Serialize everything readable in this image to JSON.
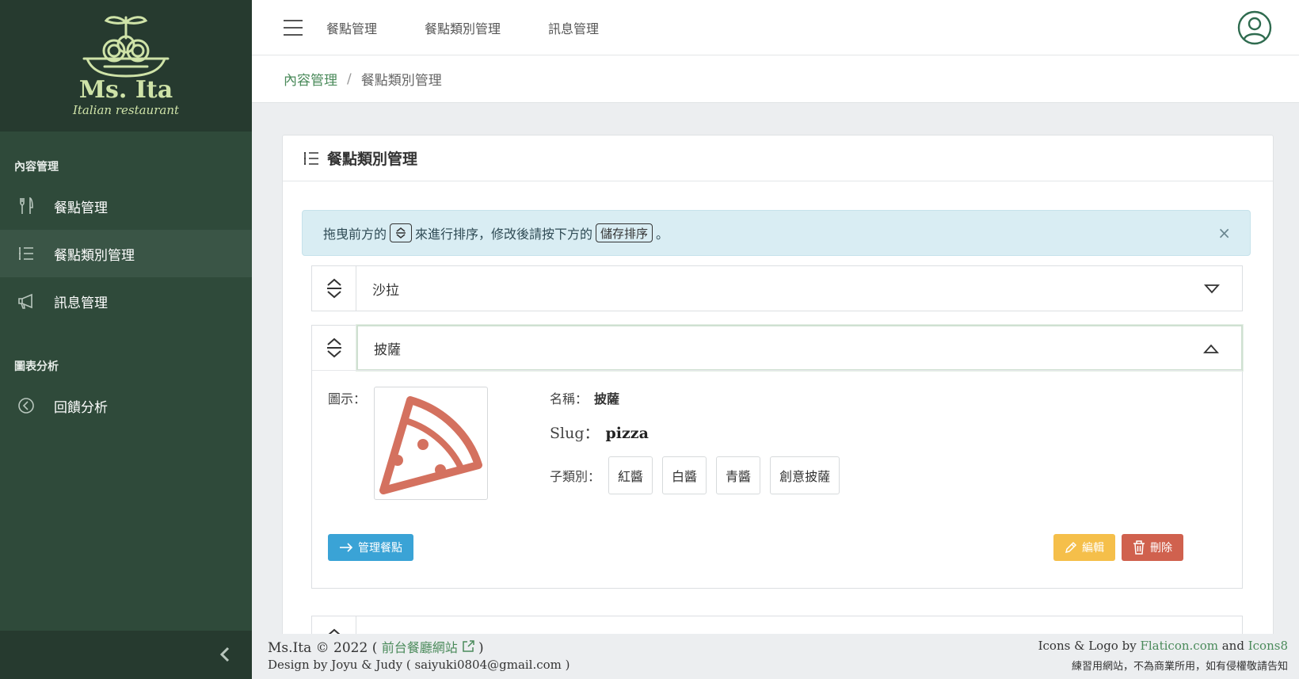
{
  "brand": {
    "name": "Ms. Ita",
    "subtitle": "Italian restaurant",
    "logo_color": "#cfe3a8"
  },
  "sidebar": {
    "sections": [
      {
        "label": "內容管理",
        "items": [
          {
            "label": "餐點管理",
            "icon": "fork-knife-icon",
            "active": false
          },
          {
            "label": "餐點類別管理",
            "icon": "list-icon",
            "active": true
          },
          {
            "label": "訊息管理",
            "icon": "megaphone-icon",
            "active": false
          }
        ]
      },
      {
        "label": "圖表分析",
        "items": [
          {
            "label": "回饋分析",
            "icon": "chart-circle-icon",
            "active": false
          }
        ]
      }
    ],
    "collapse_icon": "chevron-left-icon"
  },
  "topbar": {
    "links": [
      "餐點管理",
      "餐點類別管理",
      "訊息管理"
    ],
    "menu_icon": "hamburger-icon",
    "user_icon": "user-circle-icon"
  },
  "breadcrumb": {
    "parent": "內容管理",
    "separator": "/",
    "current": "餐點類別管理"
  },
  "card": {
    "title": "餐點類別管理",
    "alert": {
      "text_before": "拖曳前方的",
      "text_middle": "來進行排序，修改後請按下方的",
      "save_label": "儲存排序",
      "text_end": "。",
      "close": "×"
    },
    "categories": [
      {
        "name": "沙拉",
        "expanded": false
      },
      {
        "name": "披薩",
        "expanded": true,
        "icon_label": "圖示：",
        "name_label": "名稱：",
        "name_value": "披薩",
        "slug_label": "Slug：",
        "slug_value": "pizza",
        "sub_label": "子類別：",
        "subcategories": [
          "紅醬",
          "白醬",
          "青醬",
          "創意披薩"
        ]
      }
    ],
    "buttons": {
      "manage": "管理餐點",
      "edit": "編輯",
      "delete": "刪除"
    }
  },
  "colors": {
    "sidebar_bg": "#2f4a3a",
    "accent_green": "#4a8a5a",
    "manage_btn": "#3aa3d6",
    "edit_btn": "#f5bf4a",
    "delete_btn": "#d0614e",
    "pizza_icon": "#d4715f"
  },
  "footer": {
    "copyright": "Ms.Ita © 2022 (",
    "front_link": "前台餐廳網站",
    "copyright_end": ")",
    "design": "Design by Joyu & Judy ( saiyuki0804@gmail.com )",
    "credits_prefix": "Icons & Logo by",
    "flaticon": "Flaticon.com",
    "and": "and",
    "icons8": "Icons8",
    "notice": "練習用網站，不為商業所用，如有侵權敬請告知"
  }
}
